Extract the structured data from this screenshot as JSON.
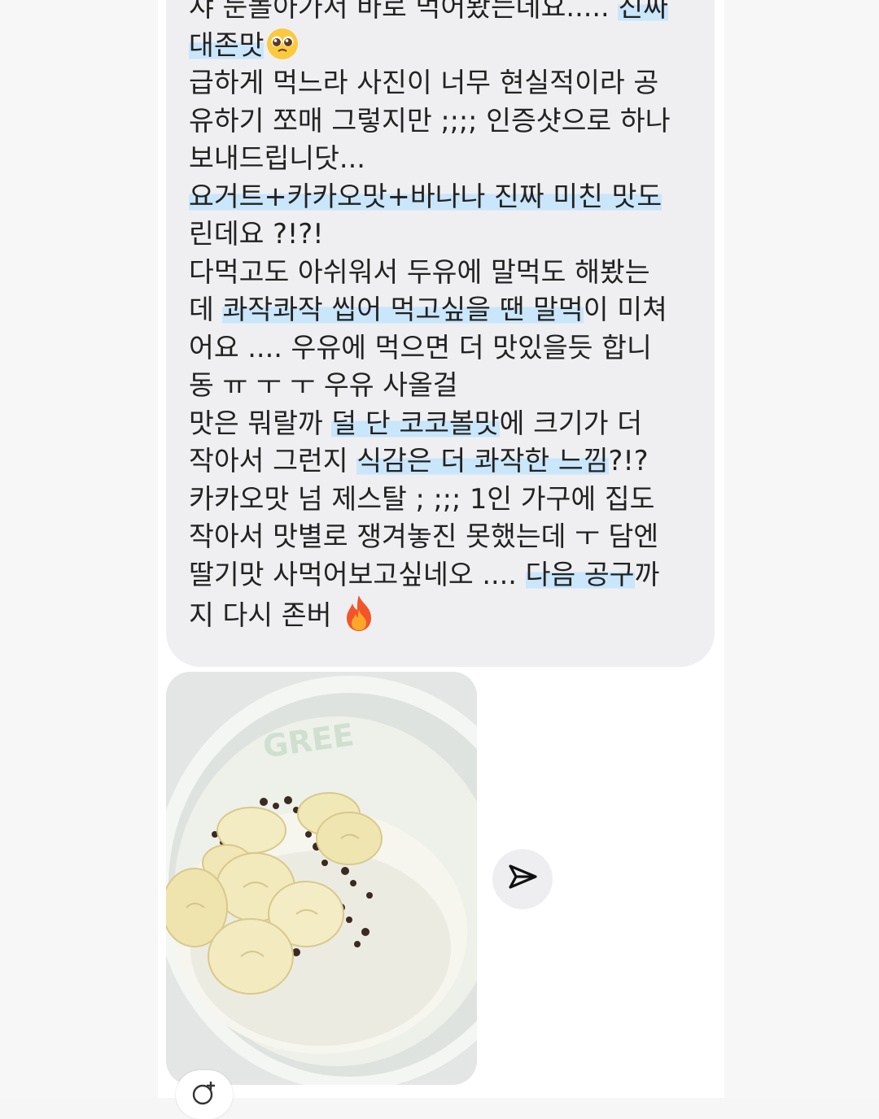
{
  "message": {
    "lines": [
      [
        {
          "t": "샤 눈돌아가서 바로 먹어봤는데요..... ",
          "hl": false
        },
        {
          "t": "진짜",
          "hl": true
        }
      ],
      [
        {
          "t": "대존맛",
          "hl": true
        }
      ],
      [
        {
          "t": "급하게 먹느라 사진이 너무 현실적이라 공",
          "hl": false
        }
      ],
      [
        {
          "t": "유하기 쪼매 그렇지만 ;;;; 인증샷으로 하나",
          "hl": false
        }
      ],
      [
        {
          "t": "보내드립니닷...",
          "hl": false
        }
      ],
      [
        {
          "t": "요거트+카카오맛+바나나 진짜 미친 맛도",
          "hl": true
        }
      ],
      [
        {
          "t": "린데요 ?!?!",
          "hl": false
        }
      ],
      [
        {
          "t": "다먹고도 아쉬워서 두유에 말먹도 해봤는",
          "hl": false
        }
      ],
      [
        {
          "t": "데 ",
          "hl": false
        },
        {
          "t": "콰작콰작 씹어 먹고싶을 땐 말먹",
          "hl": true
        },
        {
          "t": "이 미쳐",
          "hl": false
        }
      ],
      [
        {
          "t": "어요 .... 우유에 먹으면 더 맛있을듯 합니",
          "hl": false
        }
      ],
      [
        {
          "t": "동 ㅠ ㅜ ㅜ 우유 사올걸",
          "hl": false
        }
      ],
      [
        {
          "t": "맛은 뭐랄까 ",
          "hl": false
        },
        {
          "t": "덜 단 코코볼맛",
          "hl": true
        },
        {
          "t": "에 크기가 더",
          "hl": false
        }
      ],
      [
        {
          "t": "작아서 그런지 ",
          "hl": false
        },
        {
          "t": "식감은 더 콰작한 느낌",
          "hl": true
        },
        {
          "t": "?!?",
          "hl": false
        }
      ],
      [
        {
          "t": "카카오맛 넘 제스탈 ; ;;; 1인 가구에 집도",
          "hl": false
        }
      ],
      [
        {
          "t": "작아서 맛별로 쟁겨놓진 못했는데 ㅜ 담엔",
          "hl": false
        }
      ],
      [
        {
          "t": "딸기맛 사먹어보고싶네오 .... ",
          "hl": false
        },
        {
          "t": "다음 공구",
          "hl": true
        },
        {
          "t": "까",
          "hl": false
        }
      ],
      [
        {
          "t": "지 다시 존버 ",
          "hl": false
        }
      ]
    ],
    "emojis": {
      "line2": "pleading-face-icon",
      "last_line": "fire-icon"
    }
  },
  "photo": {
    "subject": "yogurt-with-banana-and-cacao-photo",
    "cup_print": "GREE"
  },
  "actions": {
    "share": "paper-plane-icon",
    "react": "add-reaction-icon"
  },
  "colors": {
    "bubble": "#efeff2",
    "highlight": "#c9e6fb",
    "text": "#222222"
  }
}
